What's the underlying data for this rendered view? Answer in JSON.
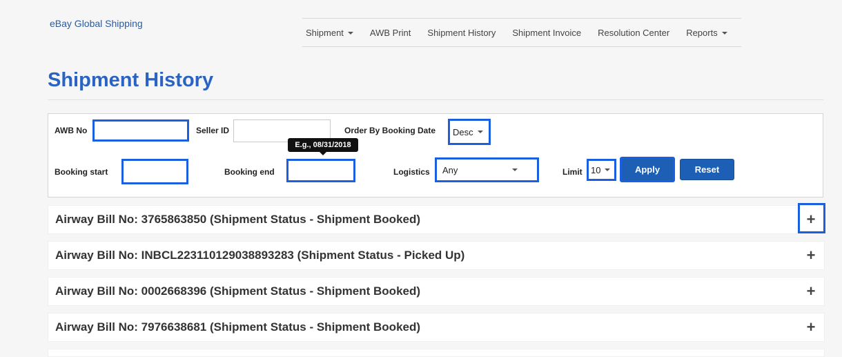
{
  "brand": "eBay Global Shipping",
  "nav": [
    {
      "label": "Shipment",
      "dropdown": true
    },
    {
      "label": "AWB Print",
      "dropdown": false
    },
    {
      "label": "Shipment History",
      "dropdown": false
    },
    {
      "label": "Shipment Invoice",
      "dropdown": false
    },
    {
      "label": "Resolution Center",
      "dropdown": false
    },
    {
      "label": "Reports",
      "dropdown": true
    }
  ],
  "page_title": "Shipment History",
  "filters": {
    "awb_label": "AWB No",
    "awb_value": "",
    "seller_label": "Seller ID",
    "seller_value": "",
    "order_label": "Order By Booking Date",
    "order_value": "Desc",
    "booking_start_label": "Booking start",
    "booking_start_value": "",
    "booking_end_label": "Booking end",
    "booking_end_value": "",
    "booking_end_tooltip": "E.g., 08/31/2018",
    "logistics_label": "Logistics",
    "logistics_value": "Any",
    "limit_label": "Limit",
    "limit_value": "10",
    "apply_label": "Apply",
    "reset_label": "Reset"
  },
  "shipments": [
    {
      "text": "Airway Bill No: 3765863850 (Shipment Status - Shipment Booked)"
    },
    {
      "text": "Airway Bill No: INBCL223110129038893283 (Shipment Status - Picked Up)"
    },
    {
      "text": "Airway Bill No: 0002668396 (Shipment Status - Shipment Booked)"
    },
    {
      "text": "Airway Bill No: 7976638681 (Shipment Status - Shipment Booked)"
    }
  ],
  "expand_icon": "+",
  "colors": {
    "accent": "#1a5fdd",
    "title": "#2b63c3",
    "button": "#1d5fb4",
    "brand_link": "#2a5b9c"
  }
}
